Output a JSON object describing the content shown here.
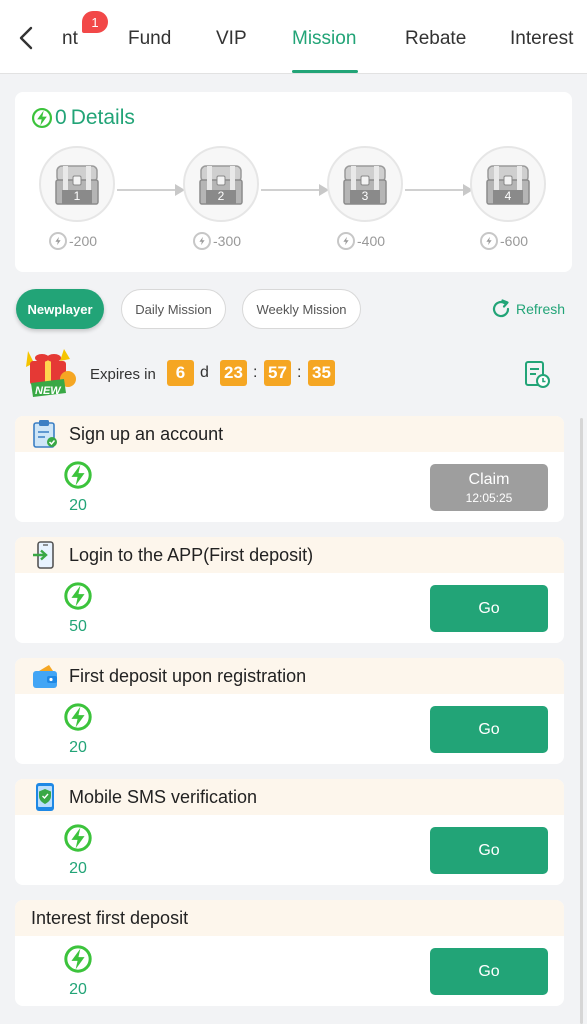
{
  "nav": {
    "tabs": [
      {
        "label": "nt"
      },
      {
        "label": "Fund"
      },
      {
        "label": "VIP"
      },
      {
        "label": "Mission"
      },
      {
        "label": "Rebate"
      },
      {
        "label": "Interest"
      }
    ],
    "active_tab": "Mission",
    "badge_count": "1",
    "back_icon": "chevron-left-icon"
  },
  "details": {
    "count": "0",
    "label": "Details",
    "chests": [
      {
        "number": "1",
        "cost": "-200"
      },
      {
        "number": "2",
        "cost": "-300"
      },
      {
        "number": "3",
        "cost": "-400"
      },
      {
        "number": "4",
        "cost": "-600"
      }
    ]
  },
  "filters": {
    "newplayer": "Newplayer",
    "daily": "Daily Mission",
    "weekly": "Weekly Mission",
    "refresh": "Refresh"
  },
  "expiry": {
    "label": "Expires in",
    "days": "6",
    "days_unit": "d",
    "hours": "23",
    "minutes": "57",
    "seconds": "35",
    "separator": ":",
    "gift_label": "NEW"
  },
  "missions": [
    {
      "title": "Sign up an account",
      "icon": "clipboard-icon",
      "reward": "20",
      "button": "Claim",
      "button_sub": "12:05:25"
    },
    {
      "title": "Login to the APP(First deposit)",
      "icon": "phone-login-icon",
      "reward": "50",
      "button": "Go"
    },
    {
      "title": "First deposit upon registration",
      "icon": "wallet-icon",
      "reward": "20",
      "button": "Go"
    },
    {
      "title": "Mobile SMS verification",
      "icon": "phone-shield-icon",
      "reward": "20",
      "button": "Go"
    },
    {
      "title": "Interest first deposit",
      "reward": "20",
      "button": "Go"
    }
  ],
  "colors": {
    "accent": "#22a477",
    "timer": "#f5a623",
    "claim_disabled": "#9e9e9e",
    "mission_header": "#fdf6ec",
    "badge": "#f24848"
  }
}
